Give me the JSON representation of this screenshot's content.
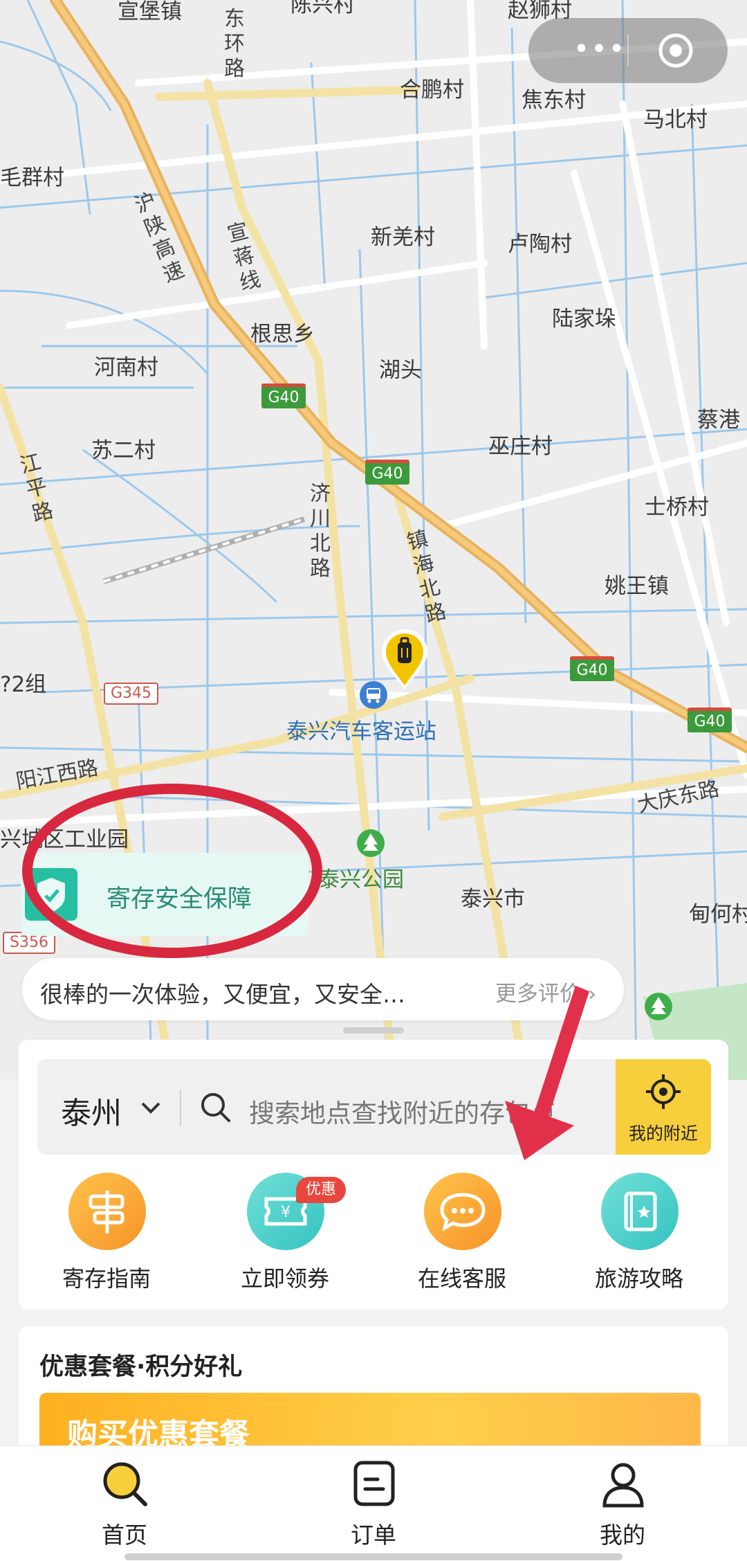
{
  "map": {
    "places": {
      "xuanbao": "宣堡镇",
      "chenxing": "陈兴村",
      "zhaoshi": "赵狮村",
      "hepeng": "合鹏村",
      "jiaodong": "焦东村",
      "mabei": "马北村",
      "maoqun": "毛群村",
      "xinqiang": "新羌村",
      "lutao": "卢陶村",
      "lujiaduo": "陆家垛",
      "gensi": "根思乡",
      "henan": "河南村",
      "hutou": "湖头",
      "caigang": "蔡港",
      "suer": "苏二村",
      "wuzhuang": "巫庄村",
      "shiqiao": "士桥村",
      "yaowang": "姚王镇",
      "zu2": "?2组",
      "station": "泰兴汽车客运站",
      "park": "泰兴公园",
      "gongyeyuan": "兴城区工业园",
      "taixing": "泰兴市",
      "dianhe": "甸何村"
    },
    "roads": {
      "donghuan": "东环路",
      "hushan": "沪陕高速",
      "xuanjiang": "宣蒋线",
      "jichuan": "济川北路",
      "zhenhai": "镇海北路",
      "jiangping": "江平路",
      "yangjiang": "阳江西路",
      "daqing": "大庆东路"
    },
    "shields": {
      "g40": "G40",
      "g345": "G345",
      "s356": "S356"
    }
  },
  "capsule": {
    "menu": "•••"
  },
  "safety": {
    "label": "寄存安全保障"
  },
  "review": {
    "text": "很棒的一次体验，又便宜，又安全…",
    "more": "更多评价 ›"
  },
  "search": {
    "city": "泰州",
    "placeholder": "搜索地点查找附近的存包点",
    "nearby": "我的附近"
  },
  "features": [
    {
      "label": "寄存指南"
    },
    {
      "label": "立即领券",
      "badge": "优惠"
    },
    {
      "label": "在线客服"
    },
    {
      "label": "旅游攻略"
    }
  ],
  "package": {
    "title": "优惠套餐·积分好礼",
    "banner": "购买优惠套餐"
  },
  "tabs": [
    {
      "label": "首页"
    },
    {
      "label": "订单"
    },
    {
      "label": "我的"
    }
  ],
  "colors": {
    "accent": "#f7cf3d",
    "annotation": "#d7283f",
    "teal": "#26bfa1"
  }
}
